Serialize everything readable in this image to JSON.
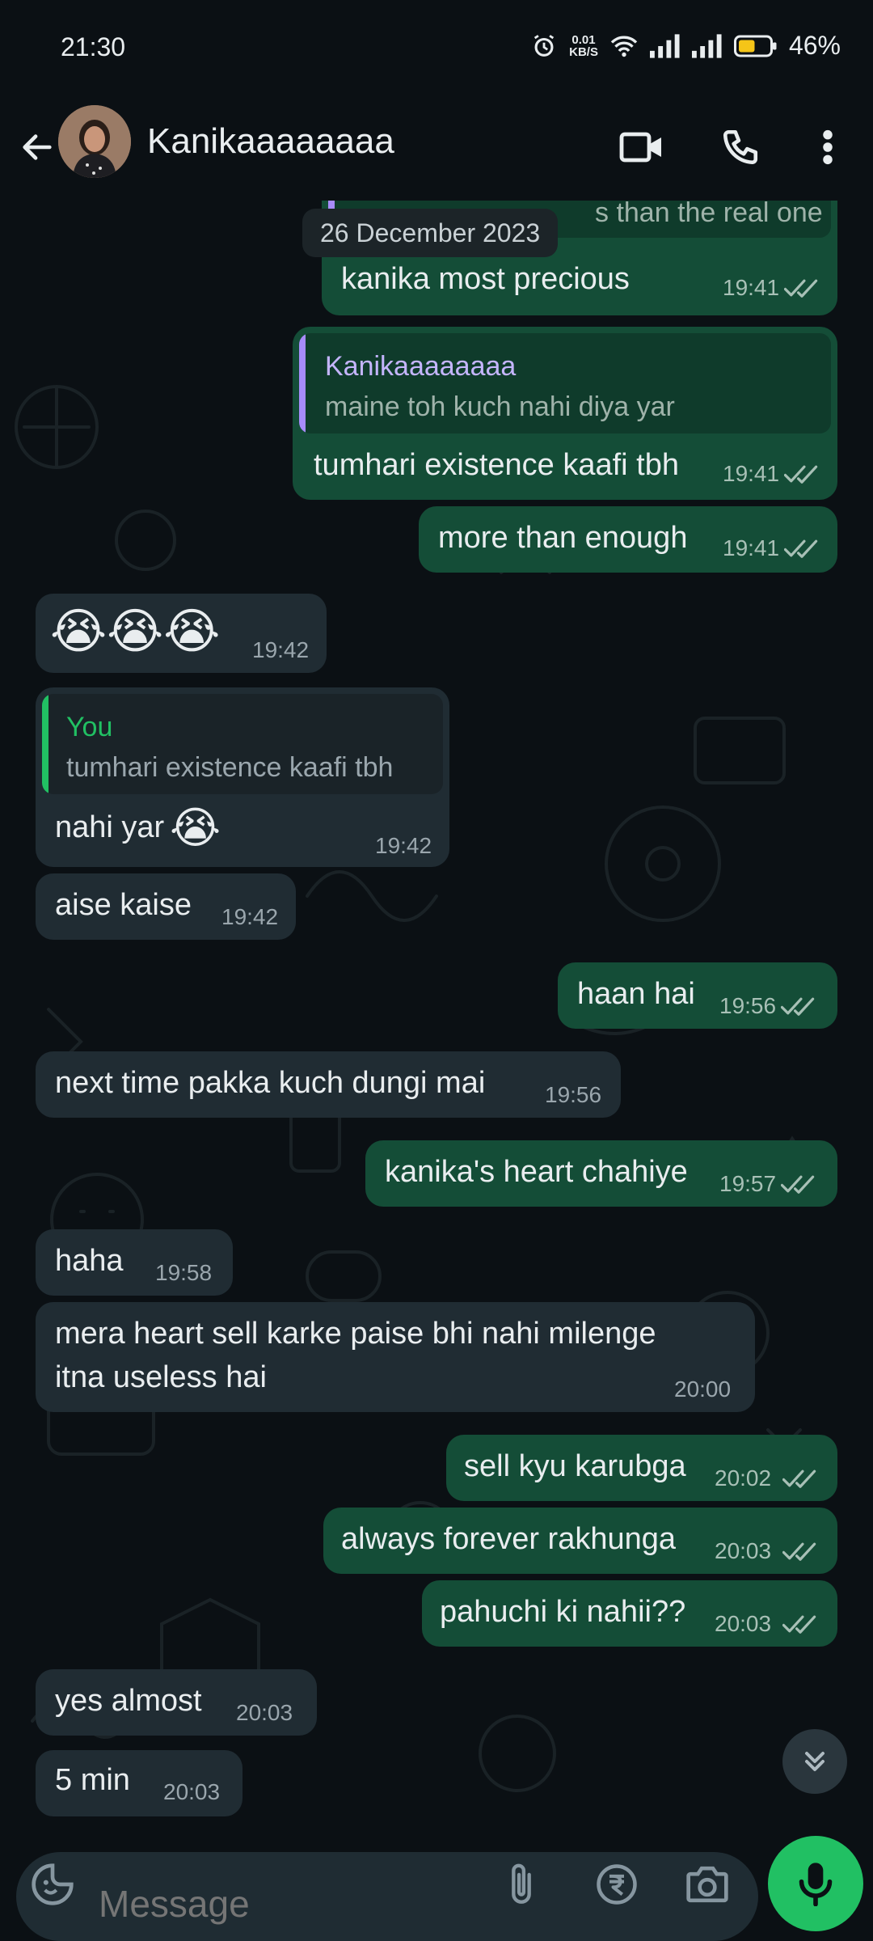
{
  "status_bar": {
    "time": "21:30",
    "net_speed_value": "0.01",
    "net_speed_unit": "KB/S",
    "battery_percent": "46%"
  },
  "header": {
    "contact_name": "Kanikaaaaaaaa",
    "icons": [
      "back-arrow-icon",
      "video-call-icon",
      "voice-call-icon",
      "more-options-icon"
    ]
  },
  "chat": {
    "date_chip": "26 December 2023",
    "partial_reply_text": "s than the real one",
    "messages": [
      {
        "dir": "out",
        "text": "kanika most precious",
        "time": "19:41"
      },
      {
        "dir": "out",
        "reply_author": "Kanikaaaaaaaa",
        "reply_text": "maine toh kuch nahi diya yar",
        "text": "tumhari existence kaafi tbh",
        "time": "19:41"
      },
      {
        "dir": "out",
        "text": "more than enough",
        "time": "19:41"
      },
      {
        "dir": "in",
        "text": "😭😭😭",
        "time": "19:42"
      },
      {
        "dir": "in",
        "reply_author": "You",
        "reply_text": "tumhari existence kaafi tbh",
        "text": "nahi yar",
        "time": "19:42"
      },
      {
        "dir": "in",
        "text": "aise kaise",
        "time": "19:42"
      },
      {
        "dir": "out",
        "text": "haan hai",
        "time": "19:56"
      },
      {
        "dir": "in",
        "text": "next time pakka kuch dungi mai",
        "time": "19:56"
      },
      {
        "dir": "out",
        "text": "kanika's heart chahiye",
        "time": "19:57"
      },
      {
        "dir": "in",
        "text": "haha",
        "time": "19:58"
      },
      {
        "dir": "in",
        "text_line1": "mera heart sell karke paise bhi nahi milenge",
        "text_line2": "itna useless hai",
        "time": "20:00"
      },
      {
        "dir": "out",
        "text": "sell kyu karubga",
        "time": "20:02"
      },
      {
        "dir": "out",
        "text": "always forever rakhunga",
        "time": "20:03"
      },
      {
        "dir": "out",
        "text": "pahuchi ki nahii??",
        "time": "20:03"
      },
      {
        "dir": "in",
        "text": "yes almost",
        "time": "20:03"
      },
      {
        "dir": "in",
        "text": "5 min",
        "time": "20:03"
      }
    ]
  },
  "composer": {
    "placeholder": "Message",
    "icons": [
      "sticker-icon",
      "attach-icon",
      "payment-rupee-icon",
      "camera-icon",
      "mic-icon"
    ]
  },
  "colors": {
    "outgoing_bubble": "#144d37",
    "incoming_bubble": "#202c33",
    "read_ticks": "#a8c0b6",
    "accent_green": "#21c063",
    "reply_bar_purple": "#a78bfa",
    "reply_bar_green": "#21c063"
  }
}
